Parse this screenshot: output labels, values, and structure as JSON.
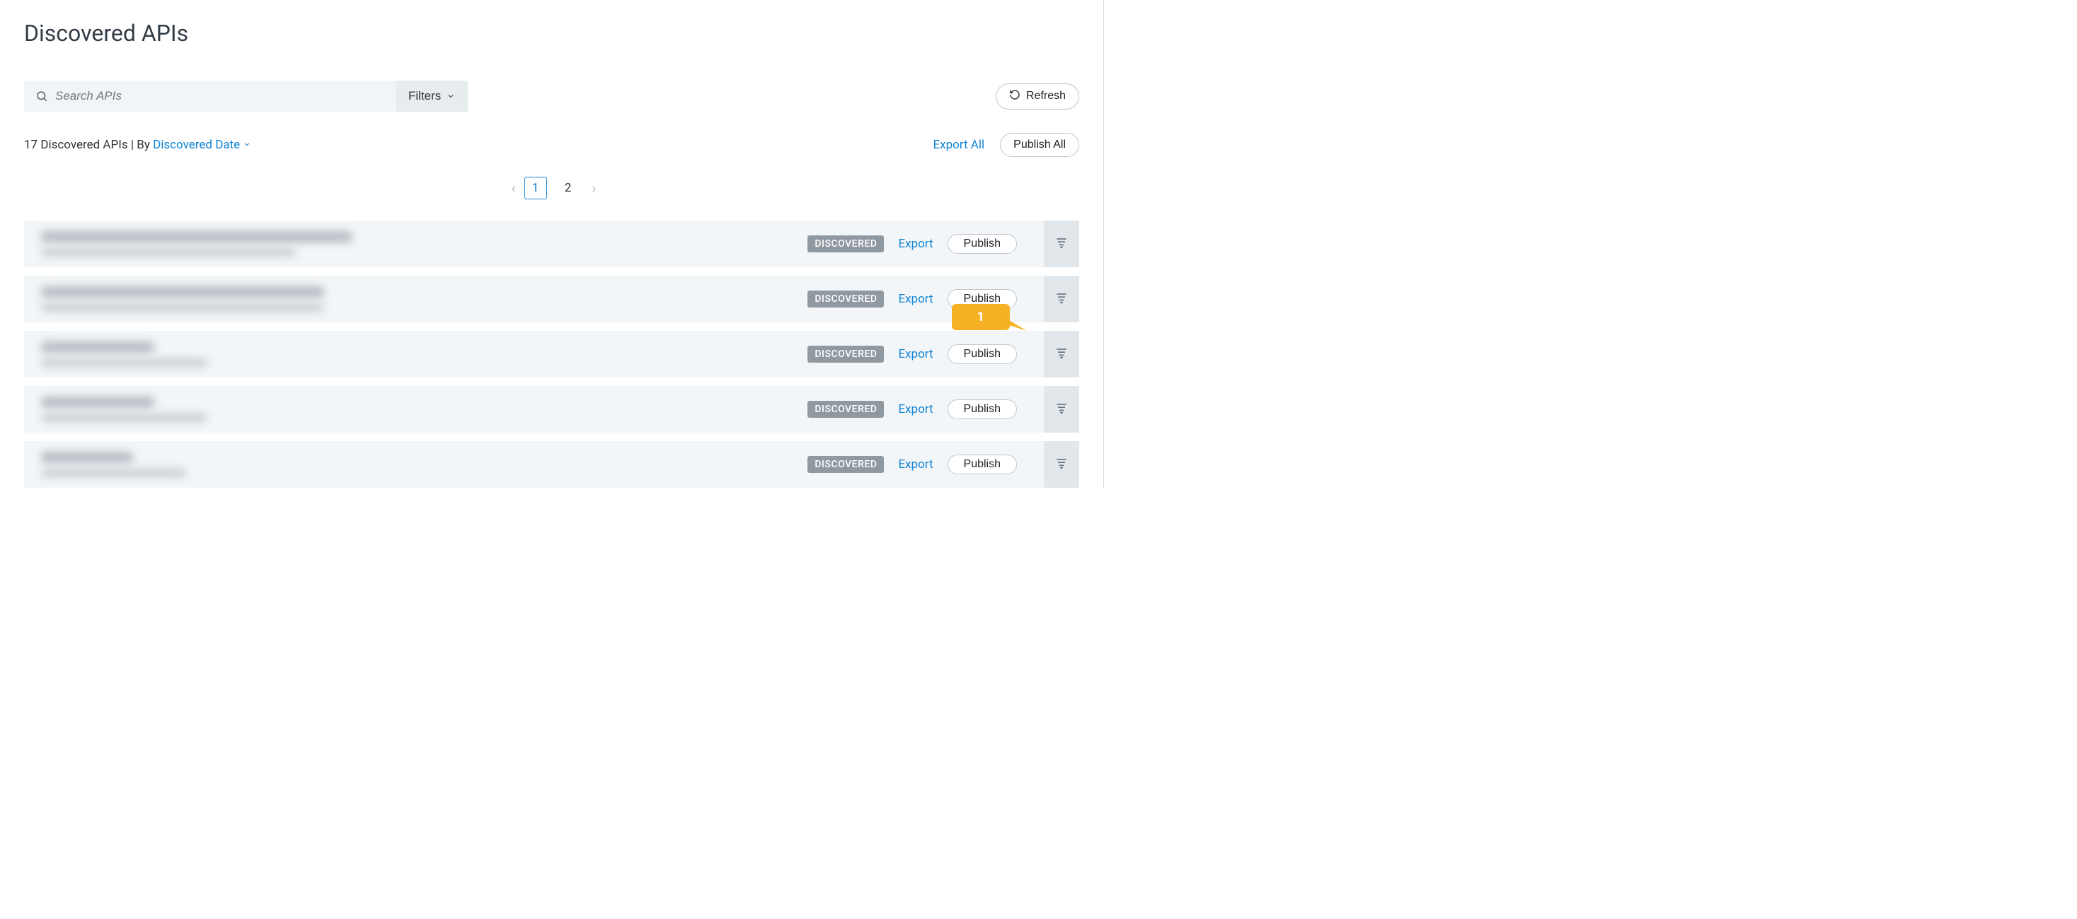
{
  "header": {
    "title": "Discovered APIs"
  },
  "search": {
    "placeholder": "Search APIs",
    "filters_label": "Filters"
  },
  "refresh_label": "Refresh",
  "meta": {
    "count_text": "17 Discovered APIs",
    "by_label": "By",
    "sort_label": "Discovered Date",
    "export_all_label": "Export All",
    "publish_all_label": "Publish All"
  },
  "pagination": {
    "pages": [
      "1",
      "2"
    ],
    "active_index": 0
  },
  "row_labels": {
    "badge": "DISCOVERED",
    "export": "Export",
    "publish": "Publish"
  },
  "callout": {
    "text": "1"
  },
  "rows": [
    {
      "title_w": 440,
      "sub_w": 360
    },
    {
      "title_w": 400,
      "sub_w": 400
    },
    {
      "title_w": 160,
      "sub_w": 235
    },
    {
      "title_w": 160,
      "sub_w": 235
    },
    {
      "title_w": 130,
      "sub_w": 205
    }
  ]
}
